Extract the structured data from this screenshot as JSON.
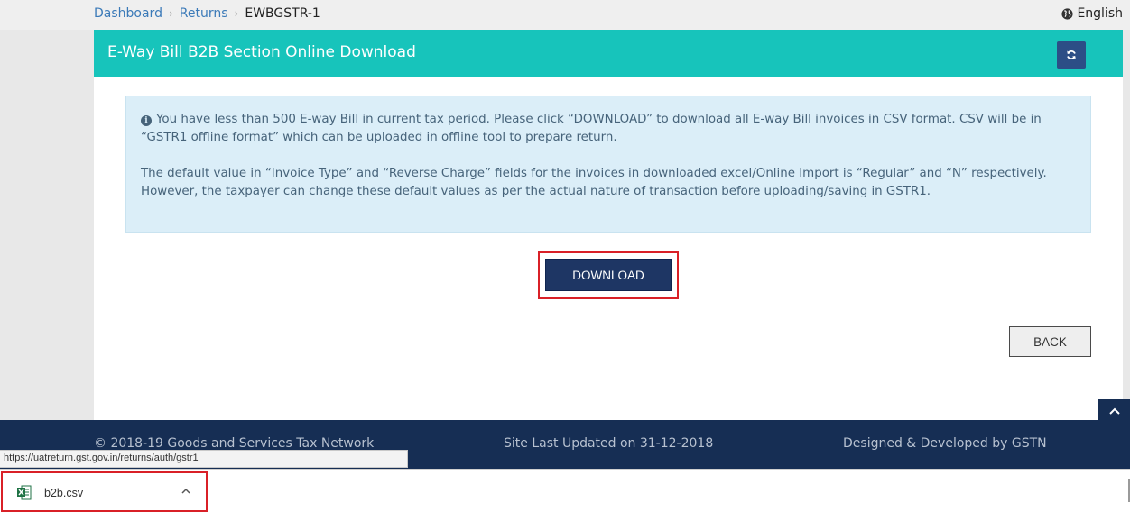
{
  "breadcrumb": {
    "items": [
      "Dashboard",
      "Returns"
    ],
    "separator": "›",
    "current": "EWBGSTR-1"
  },
  "language": {
    "label": "English",
    "icon": "globe-icon"
  },
  "panel": {
    "title": "E-Way Bill B2B Section Online Download",
    "refresh_icon": "refresh-icon",
    "header_color": "#17c4bb"
  },
  "info": {
    "icon": "info-icon",
    "paragraph1": "You have less than 500 E-way Bill in current tax period. Please click “DOWNLOAD” to download all E-way Bill invoices in CSV format. CSV will be in “GSTR1 offline format” which can be uploaded in offline tool to prepare return.",
    "paragraph2": "The default value in “Invoice Type” and “Reverse Charge” fields for the invoices in downloaded excel/Online Import is “Regular” and “N” respectively. However, the taxpayer can change these default values as per the actual nature of transaction before uploading/saving in GSTR1."
  },
  "buttons": {
    "download": "DOWNLOAD",
    "back": "BACK"
  },
  "footer": {
    "copyright": "© 2018-19 Goods and Services Tax Network",
    "updated": "Site Last Updated on 31-12-2018",
    "developer": "Designed & Developed by GSTN",
    "background": "#162e54"
  },
  "status_url": "https://uatreturn.gst.gov.in/returns/auth/gstr1",
  "download_shelf": {
    "file_name": "b2b.csv",
    "file_icon": "excel-file-icon",
    "menu_icon": "chevron-up-icon"
  }
}
